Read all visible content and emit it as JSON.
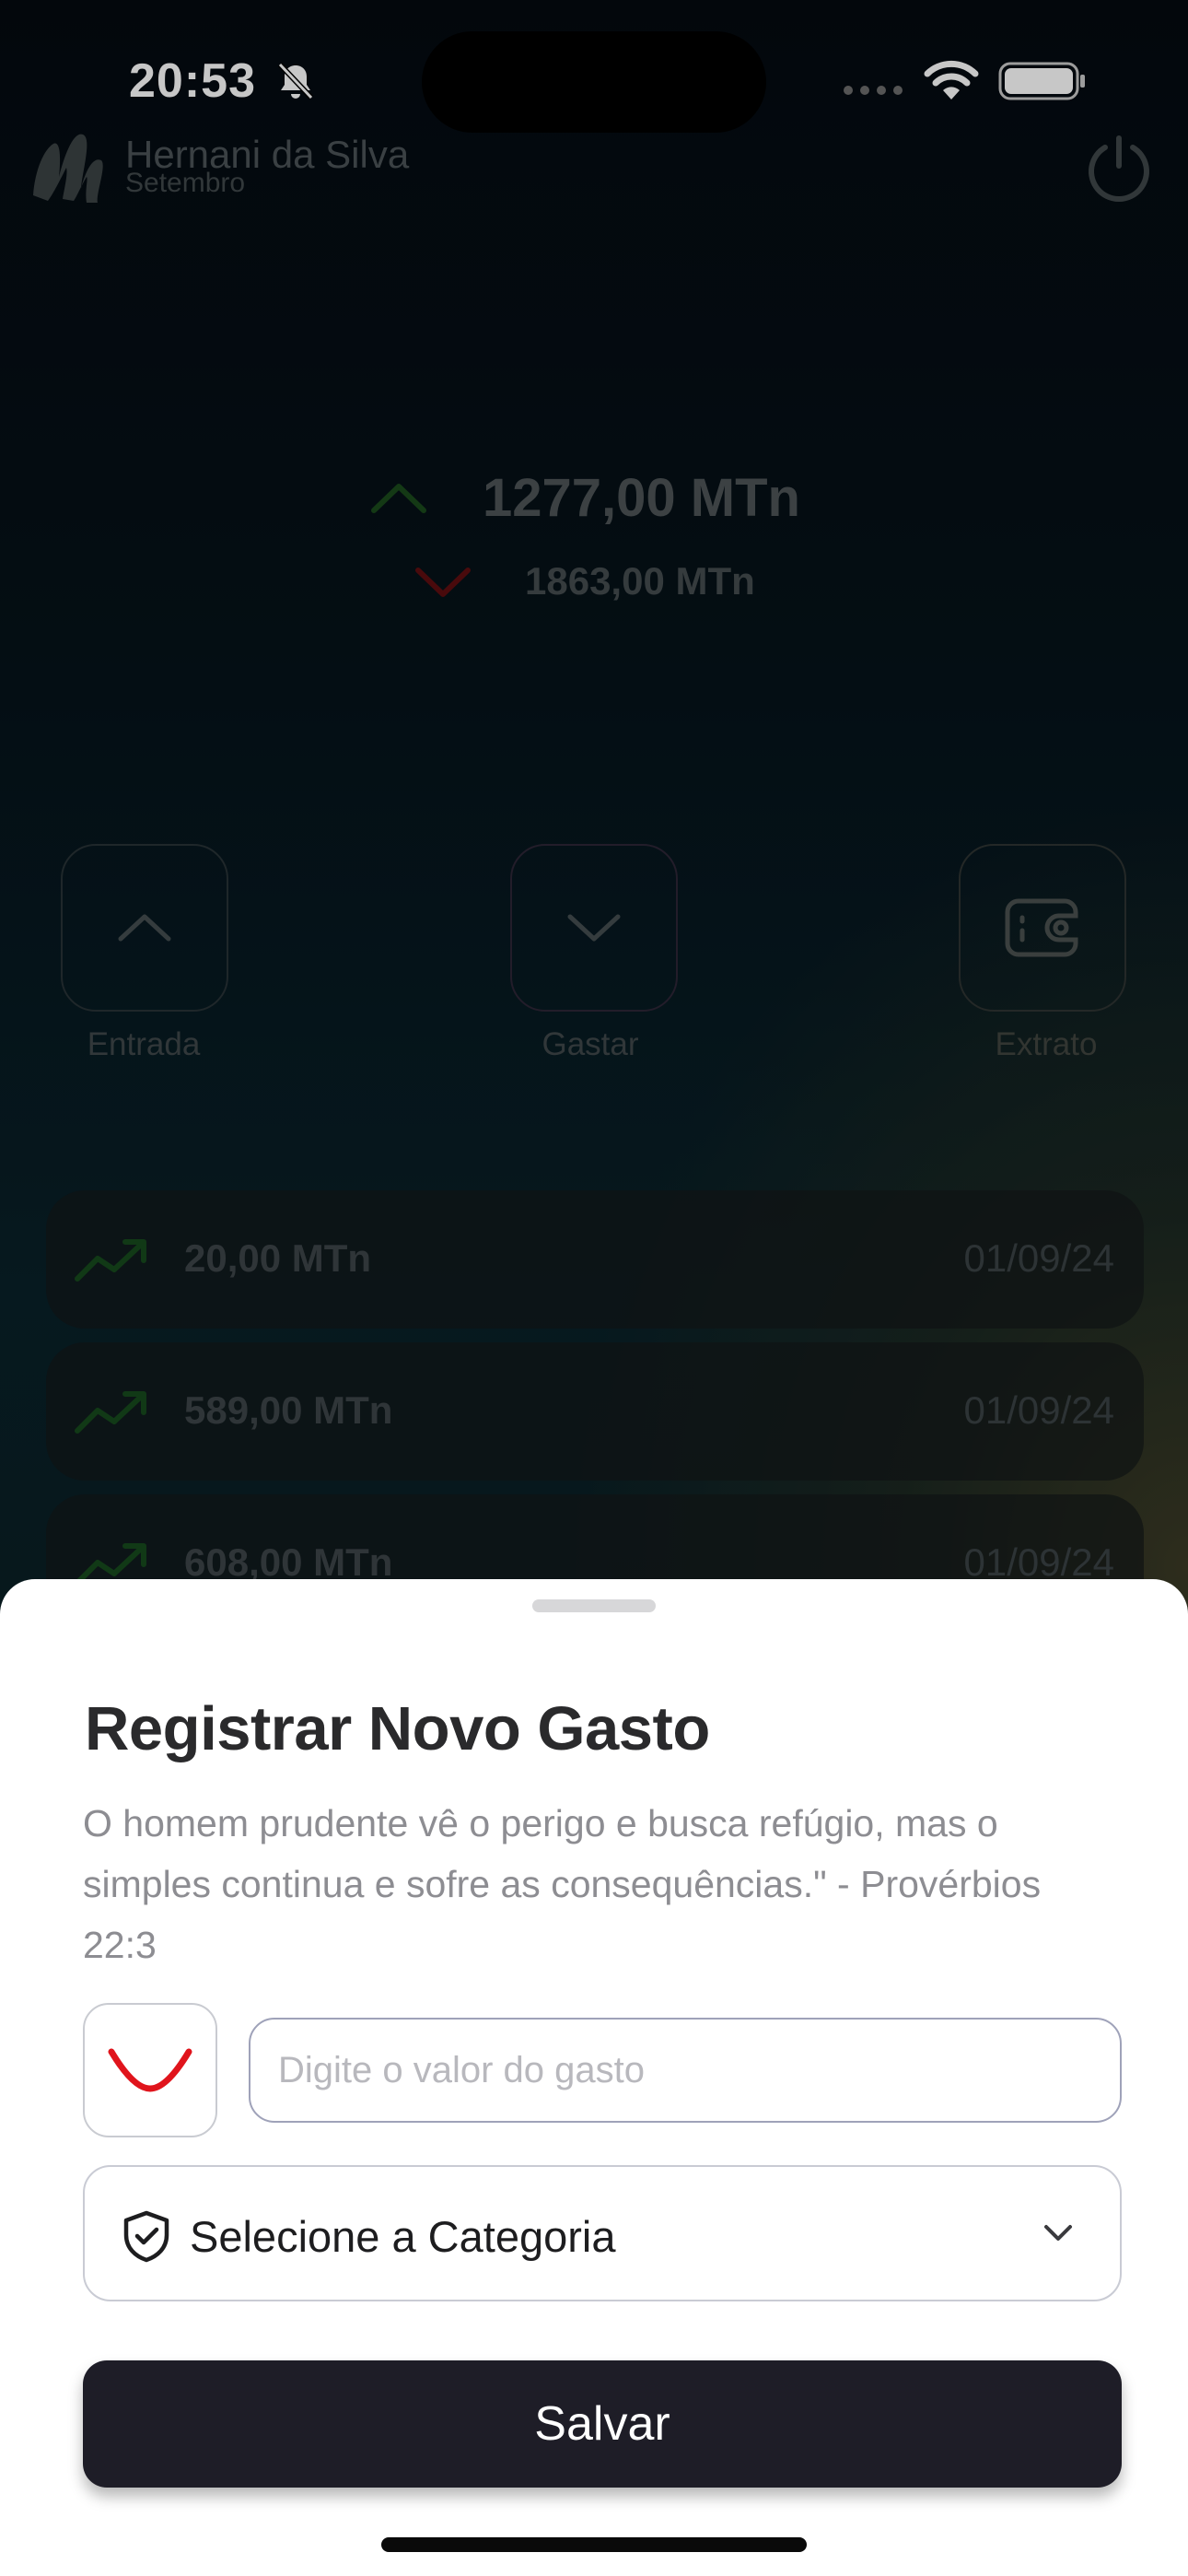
{
  "status_bar": {
    "time": "20:53",
    "icons": [
      "bell-slash-icon",
      "signal-icon",
      "wifi-icon",
      "battery-icon"
    ]
  },
  "header": {
    "user_name": "Hernani da Silva",
    "month": "Setembro",
    "logo_icon": "m-logo-icon",
    "power_icon": "power-icon"
  },
  "summary": {
    "income": "1277,00 MTn",
    "expense": "1863,00 MTn",
    "income_color": "#1f6b1f",
    "expense_color": "#7a0c0c"
  },
  "actions": [
    {
      "label": "Entrada",
      "icon": "chevron-up-icon"
    },
    {
      "label": "Gastar",
      "icon": "chevron-down-icon"
    },
    {
      "label": "Extrato",
      "icon": "wallet-icon"
    }
  ],
  "transactions": [
    {
      "amount": "20,00 MTn",
      "date": "01/09/24",
      "icon": "trend-up-icon"
    },
    {
      "amount": "589,00 MTn",
      "date": "01/09/24",
      "icon": "trend-up-icon"
    },
    {
      "amount": "608,00 MTn",
      "date": "01/09/24",
      "icon": "trend-up-icon"
    }
  ],
  "sheet": {
    "title": "Registrar Novo Gasto",
    "quote": "O homem prudente vê o perigo e busca refúgio, mas o simples continua e sofre as consequências.\" - Provérbios 22:3",
    "amount_placeholder": "Digite o valor do gasto",
    "amount_value": "",
    "category_label": "Selecione a Categoria",
    "save_label": "Salvar",
    "accent_color": "#e0141c"
  }
}
